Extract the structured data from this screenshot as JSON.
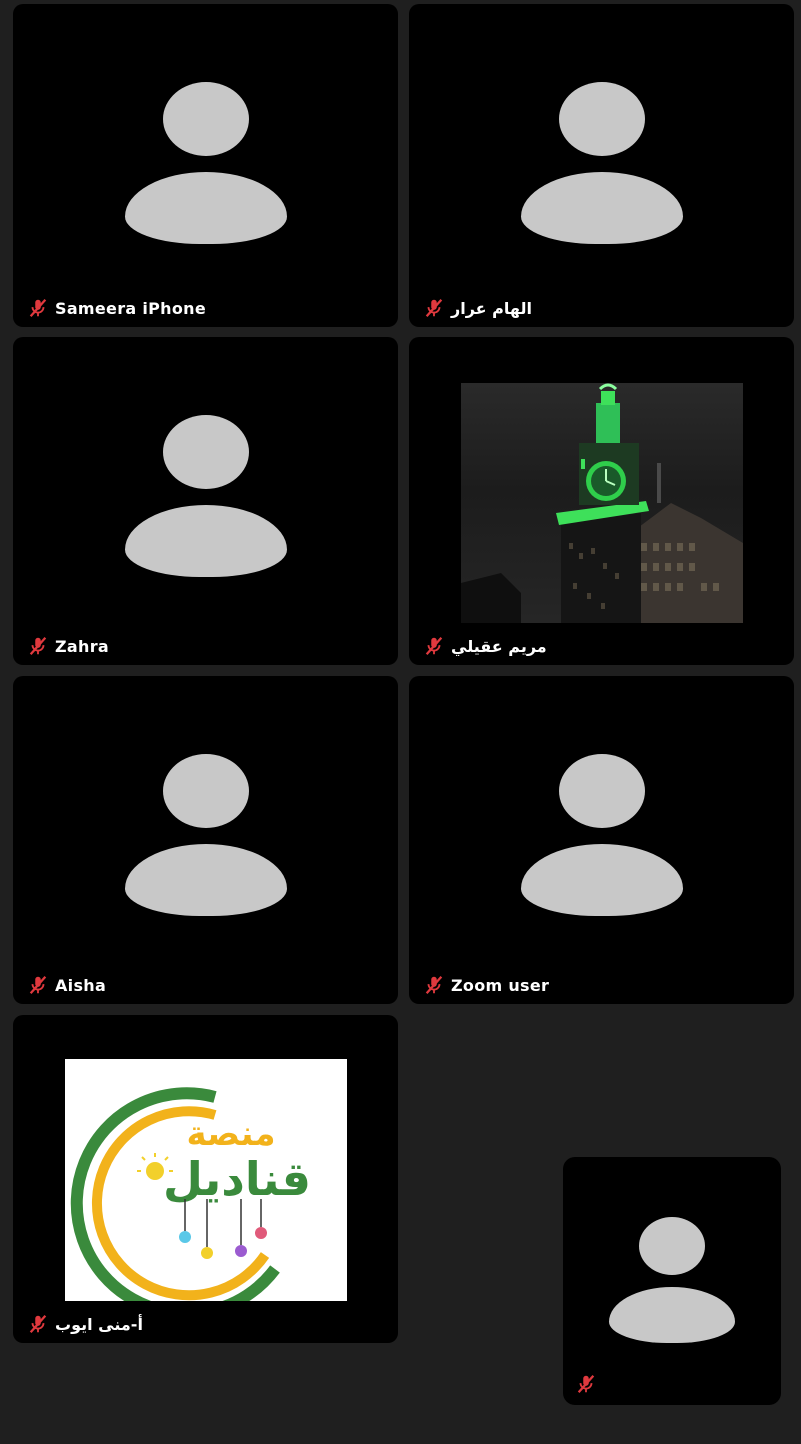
{
  "participants": [
    {
      "name": "Sameera iPhone",
      "muted": true,
      "video": "avatar"
    },
    {
      "name": "الهام عرار",
      "muted": true,
      "video": "avatar"
    },
    {
      "name": "Zahra",
      "muted": true,
      "video": "avatar"
    },
    {
      "name": "مريم عقيلي",
      "muted": true,
      "video": "clock-tower-photo"
    },
    {
      "name": "Aisha",
      "muted": true,
      "video": "avatar"
    },
    {
      "name": "Zoom user",
      "muted": true,
      "video": "avatar"
    },
    {
      "name": "أ-منى ايوب",
      "muted": true,
      "video": "qanadeel-logo"
    }
  ],
  "logo": {
    "line1": "منصة",
    "line2": "قناديل"
  },
  "self_view": {
    "muted": true,
    "video": "avatar"
  },
  "icons": {
    "muted_mic": "mic-off-icon",
    "avatar": "person-silhouette-icon"
  },
  "colors": {
    "background": "#1f1f1f",
    "tile": "#000000",
    "avatar": "#c8c8c8",
    "muted_red": "#e0393e",
    "name_text": "#ffffff",
    "logo_green": "#3a8a3c",
    "logo_yellow": "#f2b21b"
  }
}
